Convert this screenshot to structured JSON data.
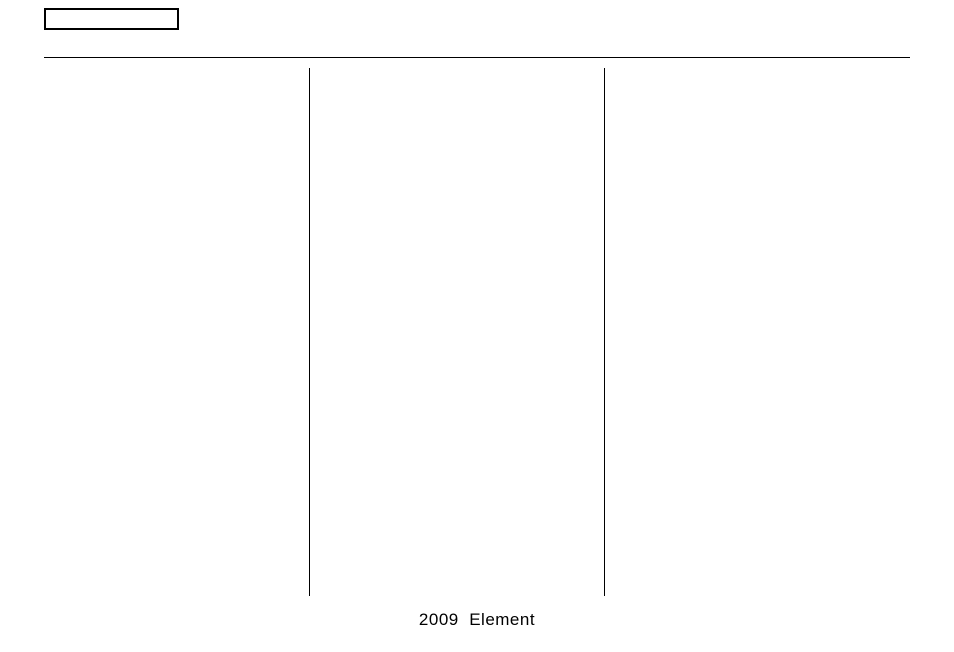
{
  "footer": {
    "year": "2009",
    "model": "Element"
  }
}
